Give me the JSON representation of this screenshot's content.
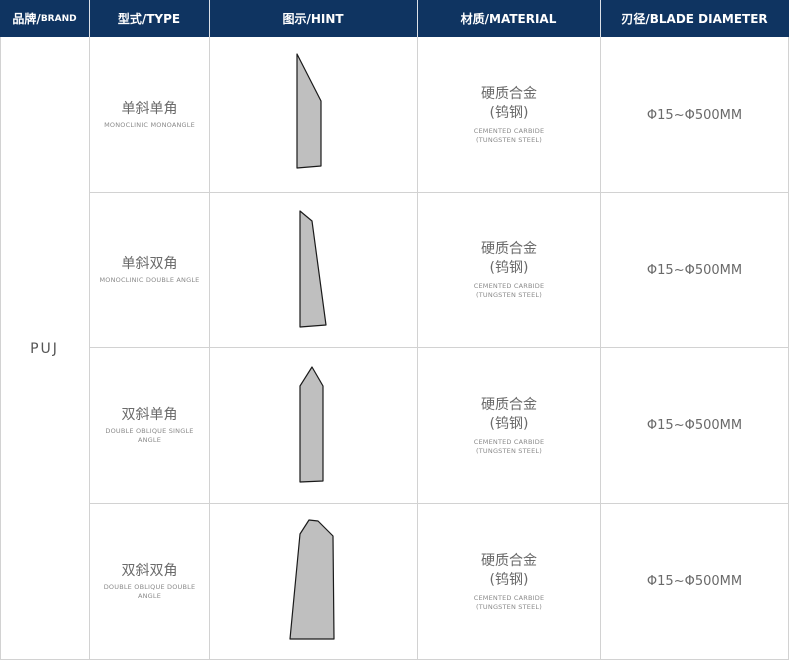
{
  "header": {
    "brand_cn": "品牌/",
    "brand_en": "BRAND",
    "type": "型式/TYPE",
    "hint": "图示/HINT",
    "material": "材质/MATERIAL",
    "diameter": "刃径/BLADE DIAMETER"
  },
  "brand": "PUJ",
  "rows": [
    {
      "type_cn": "单斜单角",
      "type_en": "MONOCLINIC MONOANGLE",
      "material_cn_1": "硬质合金",
      "material_cn_2": "(钨钢)",
      "material_en_1": "CEMENTED CARBIDE",
      "material_en_2": "(TUNGSTEN STEEL)",
      "diameter": "Φ15~Φ500MM"
    },
    {
      "type_cn": "单斜双角",
      "type_en": "MONOCLINIC DOUBLE ANGLE",
      "material_cn_1": "硬质合金",
      "material_cn_2": "(钨钢)",
      "material_en_1": "CEMENTED CARBIDE",
      "material_en_2": "(TUNGSTEN STEEL)",
      "diameter": "Φ15~Φ500MM"
    },
    {
      "type_cn": "双斜单角",
      "type_en_1": "DOUBLE OBLIQUE SINGLE",
      "type_en_2": "ANGLE",
      "material_cn_1": "硬质合金",
      "material_cn_2": "(钨钢)",
      "material_en_1": "CEMENTED CARBIDE",
      "material_en_2": "(TUNGSTEN STEEL)",
      "diameter": "Φ15~Φ500MM"
    },
    {
      "type_cn": "双斜双角",
      "type_en_1": "DOUBLE OBLIQUE DOUBLE",
      "type_en_2": "ANGLE",
      "material_cn_1": "硬质合金",
      "material_cn_2": "(钨钢)",
      "material_en_1": "CEMENTED CARBIDE",
      "material_en_2": "(TUNGSTEN STEEL)",
      "diameter": "Φ15~Φ500MM"
    }
  ],
  "colors": {
    "header_bg": "#0f3461",
    "grid_line": "#d2d2d2",
    "blade_fill": "#bfbfbf",
    "blade_stroke": "#1a1a1a"
  },
  "icons": [
    "blade-monoclinic-monoangle-icon",
    "blade-monoclinic-double-angle-icon",
    "blade-double-oblique-single-angle-icon",
    "blade-double-oblique-double-angle-icon"
  ]
}
